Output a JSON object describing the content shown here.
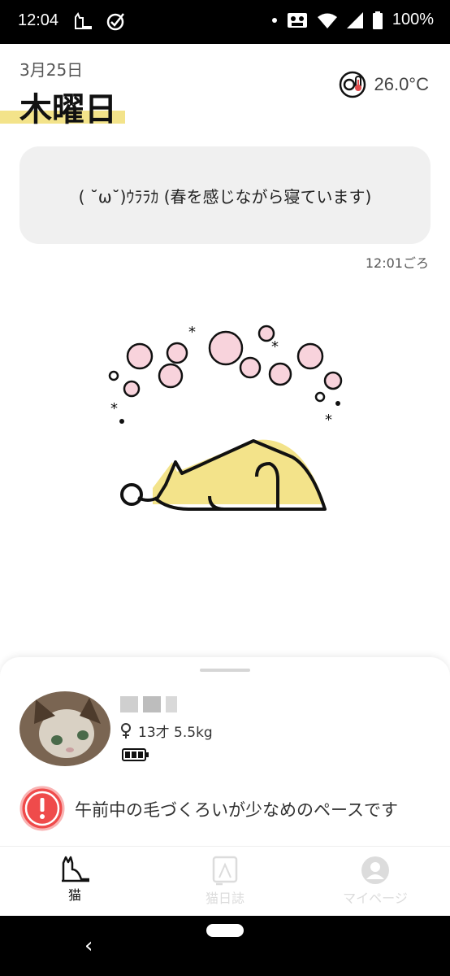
{
  "statusbar": {
    "time": "12:04",
    "battery": "100%",
    "icons": [
      "cat-notification-icon",
      "check-circle-icon",
      "dot-icon",
      "cassette-icon",
      "wifi-icon",
      "signal-icon",
      "battery-icon"
    ]
  },
  "header": {
    "date": "3月25日",
    "weekday": "木曜日",
    "temperature": "26.0°C",
    "accent_color": "#f3e38a"
  },
  "message": {
    "text": "( ˘ω˘)ｳﾗﾗｶ (春を感じながら寝ています)",
    "time": "12:01ごろ"
  },
  "cat": {
    "info": "13才 5.5kg",
    "gender_icon": "female-icon",
    "battery_level": 1.0
  },
  "alert": {
    "text": "午前中の毛づくろいが少なめのペースです",
    "color": "#ef4b4b"
  },
  "tabs": [
    {
      "label": "猫",
      "active": true
    },
    {
      "label": "猫日誌",
      "active": false
    },
    {
      "label": "マイページ",
      "active": false
    }
  ]
}
